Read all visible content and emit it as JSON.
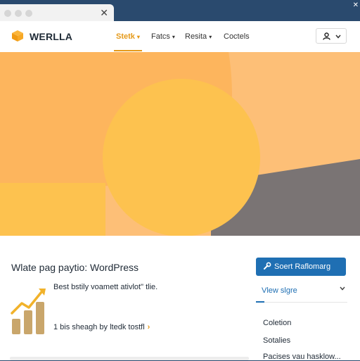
{
  "browser": {
    "close_glyph": "✕",
    "window_close_glyph": "✕"
  },
  "header": {
    "brand": "WERLLA",
    "logo_icon": "cube-icon",
    "nav": [
      {
        "label": "Stetk",
        "active": true
      },
      {
        "label": "Fatcs",
        "active": false
      },
      {
        "label": "Resita",
        "active": false
      },
      {
        "label": "Coctels",
        "active": false
      }
    ],
    "user_icon": "user-icon",
    "accent": "#e59a1a"
  },
  "hero": {
    "colors": {
      "background": "#fdbf77",
      "light_block": "#fdb55d",
      "circle": "#fdc24f",
      "dark_wedge": "#7a7474"
    }
  },
  "main": {
    "title": "Wlate pag paytio: WordPress",
    "description": "Best bstily voamett ativlot\" tlie.",
    "link_text": "1 bis sheagh by ltedk tostfl",
    "link_arrow": "›",
    "chart_icon": "bar-chart-trend-icon"
  },
  "sidebar": {
    "cta_label": "Soert Raflomarg",
    "cta_icon": "wrench-icon",
    "cta_color": "#1f6fb3",
    "view_more": "Vlew slgre",
    "links": [
      "Coletion",
      "Sotalies",
      "Pacises vau hasklow..."
    ]
  }
}
